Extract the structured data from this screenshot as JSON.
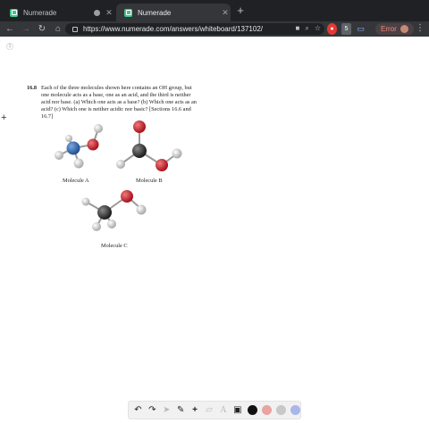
{
  "browser": {
    "tabs": [
      {
        "title": "Numerade",
        "active": false
      },
      {
        "title": "Numerade",
        "active": true
      }
    ],
    "url": "https://www.numerade.com/answers/whiteboard/137102/",
    "error_label": "Error",
    "extension_badge": "5"
  },
  "problem": {
    "number": "16.8",
    "text": "Each of the three molecules shown here contains an OH group, but one molecule acts as a base, one as an acid, and the third is neither acid nor base. (a) Which one acts as a base? (b) Which one acts as an acid? (c) Which one is neither acidic nor basic? [Sections 16.6 and 16.7]"
  },
  "molecules": {
    "a_label": "Molecule A",
    "b_label": "Molecule B",
    "c_label": "Molecule C"
  },
  "page": {
    "marker": "1"
  },
  "whiteboard_toolbar": {
    "tools": [
      "undo-icon",
      "redo-icon",
      "pointer-icon",
      "pen-icon",
      "plus-icon",
      "eraser-icon",
      "text-icon",
      "image-icon"
    ],
    "text_tool_glyph": "A",
    "colors": [
      "#111111",
      "#e8a3a3",
      "#c8c8c8",
      "#a9b6ea"
    ]
  },
  "colors": {
    "nitrogen": "#3a6fb5",
    "oxygen": "#d0202e",
    "carbon": "#3b3b3b",
    "hydrogen": "#e6e6e6"
  }
}
